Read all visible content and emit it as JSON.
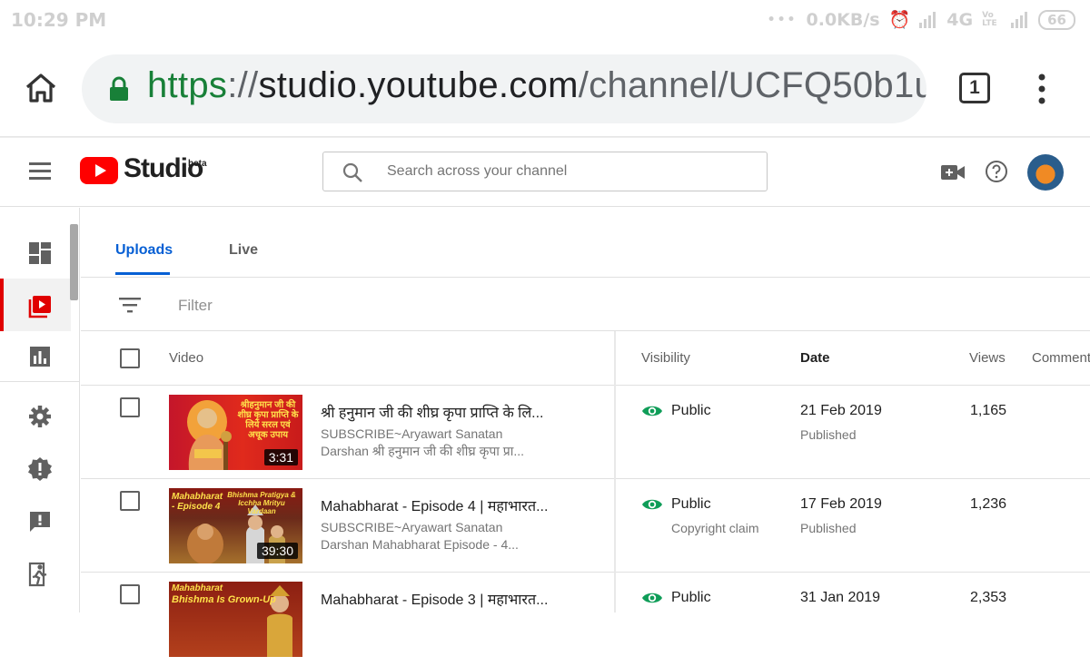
{
  "status_bar": {
    "time": "10:29 PM",
    "network_speed": "0.0KB/s",
    "network_type": "4G",
    "volte": "Vo LTE",
    "battery": "66"
  },
  "browser": {
    "url_scheme": "https",
    "url_separator": "://",
    "url_host": "studio.youtube.com",
    "url_path": "/channel/UCFQ50b1u",
    "tab_count": "1"
  },
  "header": {
    "logo_text": "Studio",
    "beta_label": "beta",
    "search_placeholder": "Search across your channel"
  },
  "tabs": {
    "uploads": "Uploads",
    "live": "Live"
  },
  "filter": {
    "placeholder": "Filter"
  },
  "columns": {
    "video": "Video",
    "visibility": "Visibility",
    "date": "Date",
    "views": "Views",
    "comments": "Comment"
  },
  "videos": [
    {
      "title": "श्री हनुमान जी की शीघ्र कृपा प्राप्ति के लि...",
      "desc_line1": "SUBSCRIBE~Aryawart Sanatan",
      "desc_line2": "Darshan श्री हनुमान जी की शीघ्र कृपा प्रा...",
      "duration": "3:31",
      "thumb_text": "श्रीहनुमान जी की शीघ्र कृपा प्राप्ति के लिये सरल एवं अचूक उपाय",
      "visibility": "Public",
      "visibility_note": "",
      "date": "21 Feb 2019",
      "date_status": "Published",
      "views": "1,165"
    },
    {
      "title": "Mahabharat - Episode 4 | महाभारत...",
      "desc_line1": "SUBSCRIBE~Aryawart Sanatan",
      "desc_line2": "Darshan Mahabharat Episode - 4...",
      "duration": "39:30",
      "thumb_text": "Mahabharat - Episode 4",
      "thumb_text2": "Bhishma Pratigya & Icchha Mrityu Vardaan",
      "visibility": "Public",
      "visibility_note": "Copyright claim",
      "date": "17 Feb 2019",
      "date_status": "Published",
      "views": "1,236"
    },
    {
      "title": "Mahabharat - Episode 3 | महाभारत...",
      "thumb_text": "Mahabharat",
      "thumb_text2": "Bhishma Is Grown-Up",
      "visibility": "Public",
      "date": "31 Jan 2019",
      "views": "2,353"
    }
  ],
  "colors": {
    "accent_blue": "#065fd4",
    "youtube_red": "#ff0000",
    "public_green": "#0f9d58",
    "active_nav_red": "#e00000"
  }
}
